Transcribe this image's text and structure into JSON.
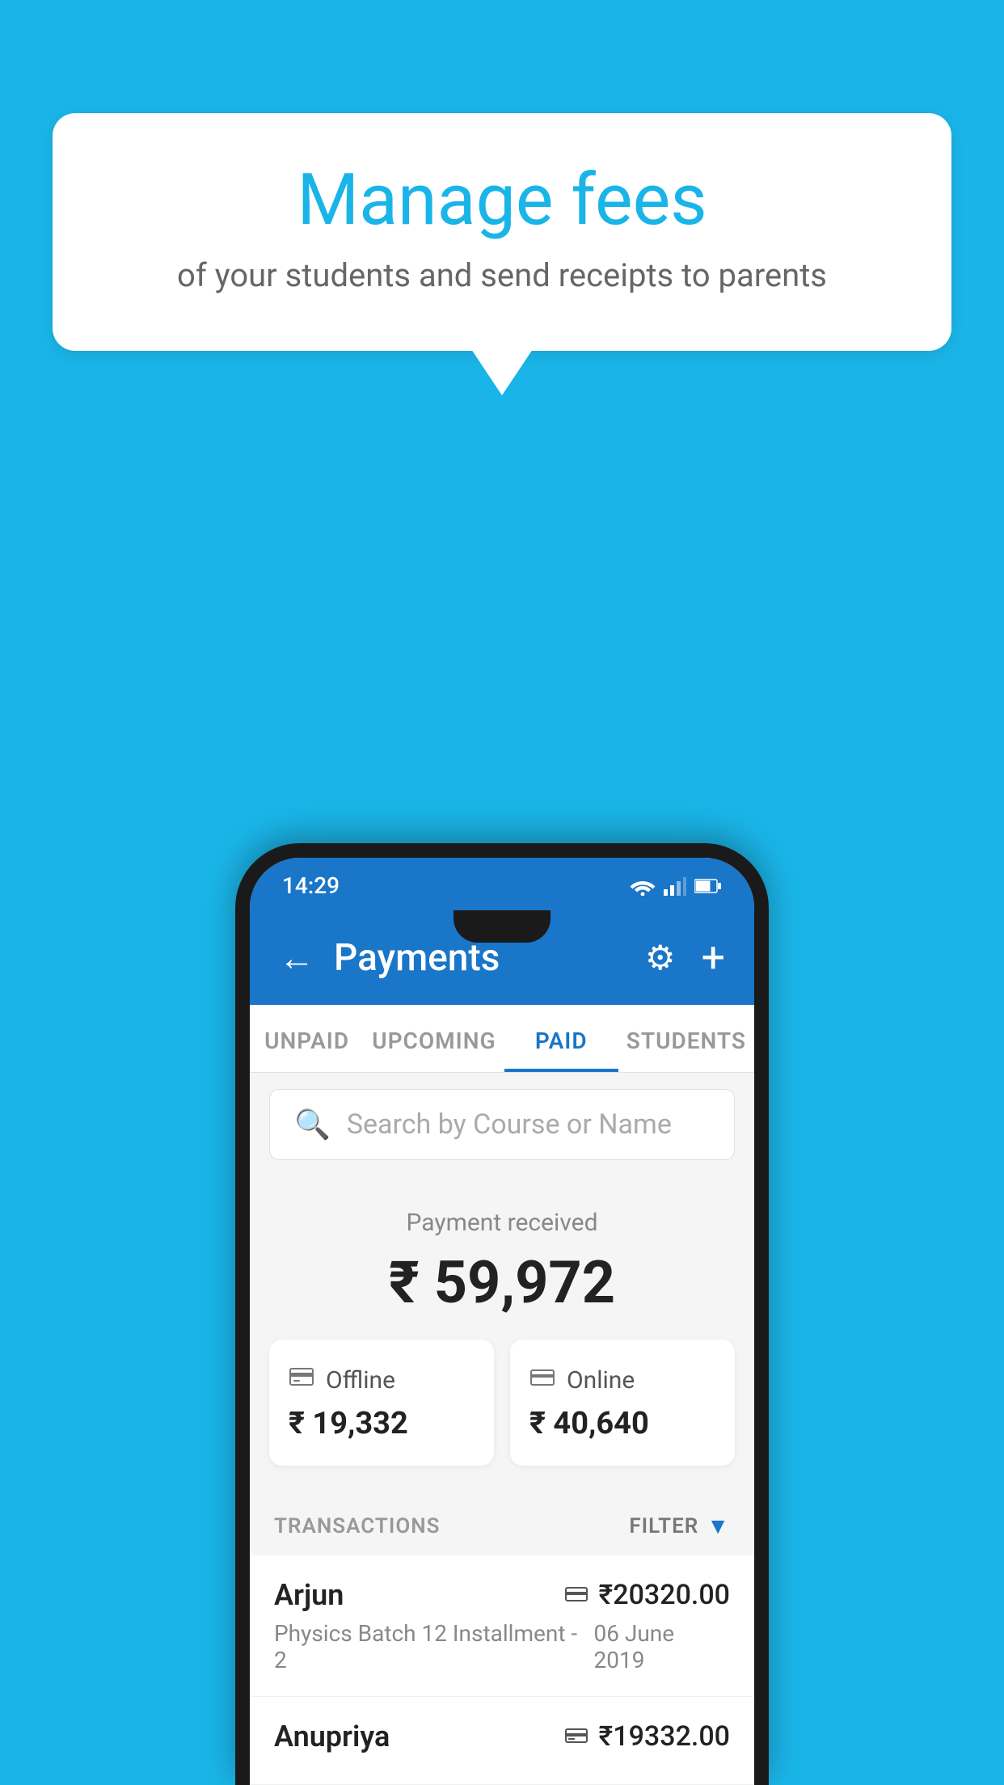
{
  "background_color": "#1ab5e8",
  "speech_bubble": {
    "title": "Manage fees",
    "subtitle": "of your students and send receipts to parents"
  },
  "status_bar": {
    "time": "14:29",
    "wifi": "▲",
    "signal": "▲",
    "battery": "▮"
  },
  "header": {
    "title": "Payments",
    "back_icon": "←",
    "settings_icon": "⚙",
    "add_icon": "+"
  },
  "tabs": [
    {
      "label": "UNPAID",
      "active": false
    },
    {
      "label": "UPCOMING",
      "active": false
    },
    {
      "label": "PAID",
      "active": true
    },
    {
      "label": "STUDENTS",
      "active": false
    }
  ],
  "search": {
    "placeholder": "Search by Course or Name"
  },
  "payment_received": {
    "label": "Payment received",
    "total": "₹ 59,972",
    "offline": {
      "type": "Offline",
      "amount": "₹ 19,332"
    },
    "online": {
      "type": "Online",
      "amount": "₹ 40,640"
    }
  },
  "transactions": {
    "label": "TRANSACTIONS",
    "filter_label": "FILTER",
    "items": [
      {
        "name": "Arjun",
        "course": "Physics Batch 12 Installment - 2",
        "amount": "₹20320.00",
        "date": "06 June 2019",
        "payment_type": "card"
      },
      {
        "name": "Anupriya",
        "course": "",
        "amount": "₹19332.00",
        "date": "",
        "payment_type": "offline"
      }
    ]
  }
}
